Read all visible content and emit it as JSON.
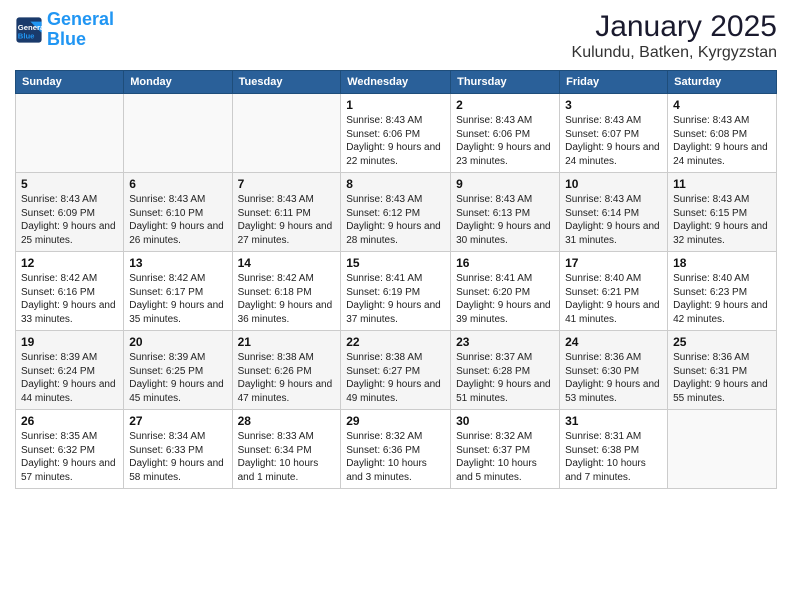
{
  "logo": {
    "line1": "General",
    "line2": "Blue"
  },
  "title": "January 2025",
  "subtitle": "Kulundu, Batken, Kyrgyzstan",
  "weekdays": [
    "Sunday",
    "Monday",
    "Tuesday",
    "Wednesday",
    "Thursday",
    "Friday",
    "Saturday"
  ],
  "weeks": [
    [
      {
        "day": "",
        "info": ""
      },
      {
        "day": "",
        "info": ""
      },
      {
        "day": "",
        "info": ""
      },
      {
        "day": "1",
        "info": "Sunrise: 8:43 AM\nSunset: 6:06 PM\nDaylight: 9 hours and 22 minutes."
      },
      {
        "day": "2",
        "info": "Sunrise: 8:43 AM\nSunset: 6:06 PM\nDaylight: 9 hours and 23 minutes."
      },
      {
        "day": "3",
        "info": "Sunrise: 8:43 AM\nSunset: 6:07 PM\nDaylight: 9 hours and 24 minutes."
      },
      {
        "day": "4",
        "info": "Sunrise: 8:43 AM\nSunset: 6:08 PM\nDaylight: 9 hours and 24 minutes."
      }
    ],
    [
      {
        "day": "5",
        "info": "Sunrise: 8:43 AM\nSunset: 6:09 PM\nDaylight: 9 hours and 25 minutes."
      },
      {
        "day": "6",
        "info": "Sunrise: 8:43 AM\nSunset: 6:10 PM\nDaylight: 9 hours and 26 minutes."
      },
      {
        "day": "7",
        "info": "Sunrise: 8:43 AM\nSunset: 6:11 PM\nDaylight: 9 hours and 27 minutes."
      },
      {
        "day": "8",
        "info": "Sunrise: 8:43 AM\nSunset: 6:12 PM\nDaylight: 9 hours and 28 minutes."
      },
      {
        "day": "9",
        "info": "Sunrise: 8:43 AM\nSunset: 6:13 PM\nDaylight: 9 hours and 30 minutes."
      },
      {
        "day": "10",
        "info": "Sunrise: 8:43 AM\nSunset: 6:14 PM\nDaylight: 9 hours and 31 minutes."
      },
      {
        "day": "11",
        "info": "Sunrise: 8:43 AM\nSunset: 6:15 PM\nDaylight: 9 hours and 32 minutes."
      }
    ],
    [
      {
        "day": "12",
        "info": "Sunrise: 8:42 AM\nSunset: 6:16 PM\nDaylight: 9 hours and 33 minutes."
      },
      {
        "day": "13",
        "info": "Sunrise: 8:42 AM\nSunset: 6:17 PM\nDaylight: 9 hours and 35 minutes."
      },
      {
        "day": "14",
        "info": "Sunrise: 8:42 AM\nSunset: 6:18 PM\nDaylight: 9 hours and 36 minutes."
      },
      {
        "day": "15",
        "info": "Sunrise: 8:41 AM\nSunset: 6:19 PM\nDaylight: 9 hours and 37 minutes."
      },
      {
        "day": "16",
        "info": "Sunrise: 8:41 AM\nSunset: 6:20 PM\nDaylight: 9 hours and 39 minutes."
      },
      {
        "day": "17",
        "info": "Sunrise: 8:40 AM\nSunset: 6:21 PM\nDaylight: 9 hours and 41 minutes."
      },
      {
        "day": "18",
        "info": "Sunrise: 8:40 AM\nSunset: 6:23 PM\nDaylight: 9 hours and 42 minutes."
      }
    ],
    [
      {
        "day": "19",
        "info": "Sunrise: 8:39 AM\nSunset: 6:24 PM\nDaylight: 9 hours and 44 minutes."
      },
      {
        "day": "20",
        "info": "Sunrise: 8:39 AM\nSunset: 6:25 PM\nDaylight: 9 hours and 45 minutes."
      },
      {
        "day": "21",
        "info": "Sunrise: 8:38 AM\nSunset: 6:26 PM\nDaylight: 9 hours and 47 minutes."
      },
      {
        "day": "22",
        "info": "Sunrise: 8:38 AM\nSunset: 6:27 PM\nDaylight: 9 hours and 49 minutes."
      },
      {
        "day": "23",
        "info": "Sunrise: 8:37 AM\nSunset: 6:28 PM\nDaylight: 9 hours and 51 minutes."
      },
      {
        "day": "24",
        "info": "Sunrise: 8:36 AM\nSunset: 6:30 PM\nDaylight: 9 hours and 53 minutes."
      },
      {
        "day": "25",
        "info": "Sunrise: 8:36 AM\nSunset: 6:31 PM\nDaylight: 9 hours and 55 minutes."
      }
    ],
    [
      {
        "day": "26",
        "info": "Sunrise: 8:35 AM\nSunset: 6:32 PM\nDaylight: 9 hours and 57 minutes."
      },
      {
        "day": "27",
        "info": "Sunrise: 8:34 AM\nSunset: 6:33 PM\nDaylight: 9 hours and 58 minutes."
      },
      {
        "day": "28",
        "info": "Sunrise: 8:33 AM\nSunset: 6:34 PM\nDaylight: 10 hours and 1 minute."
      },
      {
        "day": "29",
        "info": "Sunrise: 8:32 AM\nSunset: 6:36 PM\nDaylight: 10 hours and 3 minutes."
      },
      {
        "day": "30",
        "info": "Sunrise: 8:32 AM\nSunset: 6:37 PM\nDaylight: 10 hours and 5 minutes."
      },
      {
        "day": "31",
        "info": "Sunrise: 8:31 AM\nSunset: 6:38 PM\nDaylight: 10 hours and 7 minutes."
      },
      {
        "day": "",
        "info": ""
      }
    ]
  ]
}
